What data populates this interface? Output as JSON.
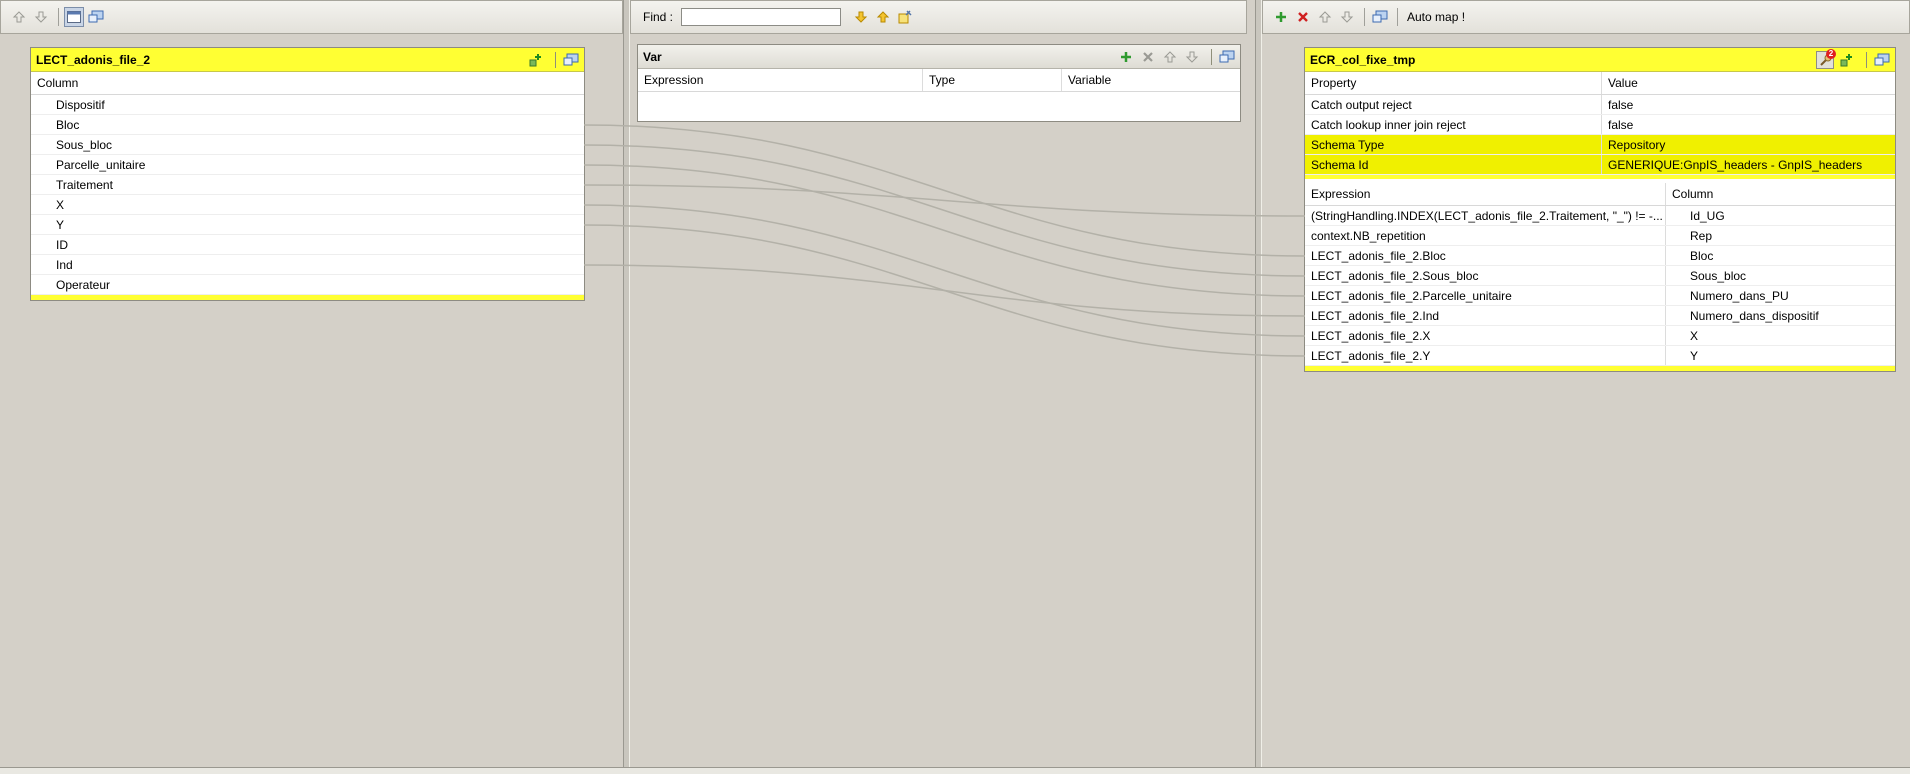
{
  "left": {
    "toolbar": {
      "icons": [
        "arrow-up-icon",
        "arrow-down-icon",
        "window-icon",
        "display-icon"
      ]
    },
    "table": {
      "title": "LECT_adonis_file_2",
      "header": "Column",
      "rows": [
        "Dispositif",
        "Bloc",
        "Sous_bloc",
        "Parcelle_unitaire",
        "Traitement",
        "X",
        "Y",
        "ID",
        "Ind",
        "Operateur"
      ]
    }
  },
  "middle": {
    "toolbar": {
      "find_label": "Find :",
      "find_value": ""
    },
    "var_table": {
      "title": "Var",
      "headers": [
        "Expression",
        "Type",
        "Variable"
      ]
    }
  },
  "right": {
    "toolbar": {
      "auto_map_label": "Auto map !"
    },
    "table": {
      "title": "ECR_col_fixe_tmp",
      "badge": "2",
      "prop_headers": [
        "Property",
        "Value"
      ],
      "properties": [
        {
          "name": "Catch output reject",
          "value": "false"
        },
        {
          "name": "Catch lookup inner join reject",
          "value": "false"
        },
        {
          "name": "Schema Type",
          "value": "Repository"
        },
        {
          "name": "Schema Id",
          "value": "GENERIQUE:GnpIS_headers - GnpIS_headers"
        }
      ],
      "expr_headers": [
        "Expression",
        "Column"
      ],
      "mappings": [
        {
          "expression": "(StringHandling.INDEX(LECT_adonis_file_2.Traitement, \"_\") != -...",
          "column": "Id_UG"
        },
        {
          "expression": "context.NB_repetition",
          "column": "Rep"
        },
        {
          "expression": "LECT_adonis_file_2.Bloc",
          "column": "Bloc"
        },
        {
          "expression": "LECT_adonis_file_2.Sous_bloc",
          "column": "Sous_bloc"
        },
        {
          "expression": "LECT_adonis_file_2.Parcelle_unitaire",
          "column": "Numero_dans_PU"
        },
        {
          "expression": "LECT_adonis_file_2.Ind",
          "column": "Numero_dans_dispositif"
        },
        {
          "expression": "LECT_adonis_file_2.X",
          "column": "X"
        },
        {
          "expression": "LECT_adonis_file_2.Y",
          "column": "Y"
        }
      ]
    }
  },
  "colors": {
    "title_yellow": "#ffff33",
    "highlight_yellow": "#f0f000",
    "wire": "#b3b1a8"
  }
}
